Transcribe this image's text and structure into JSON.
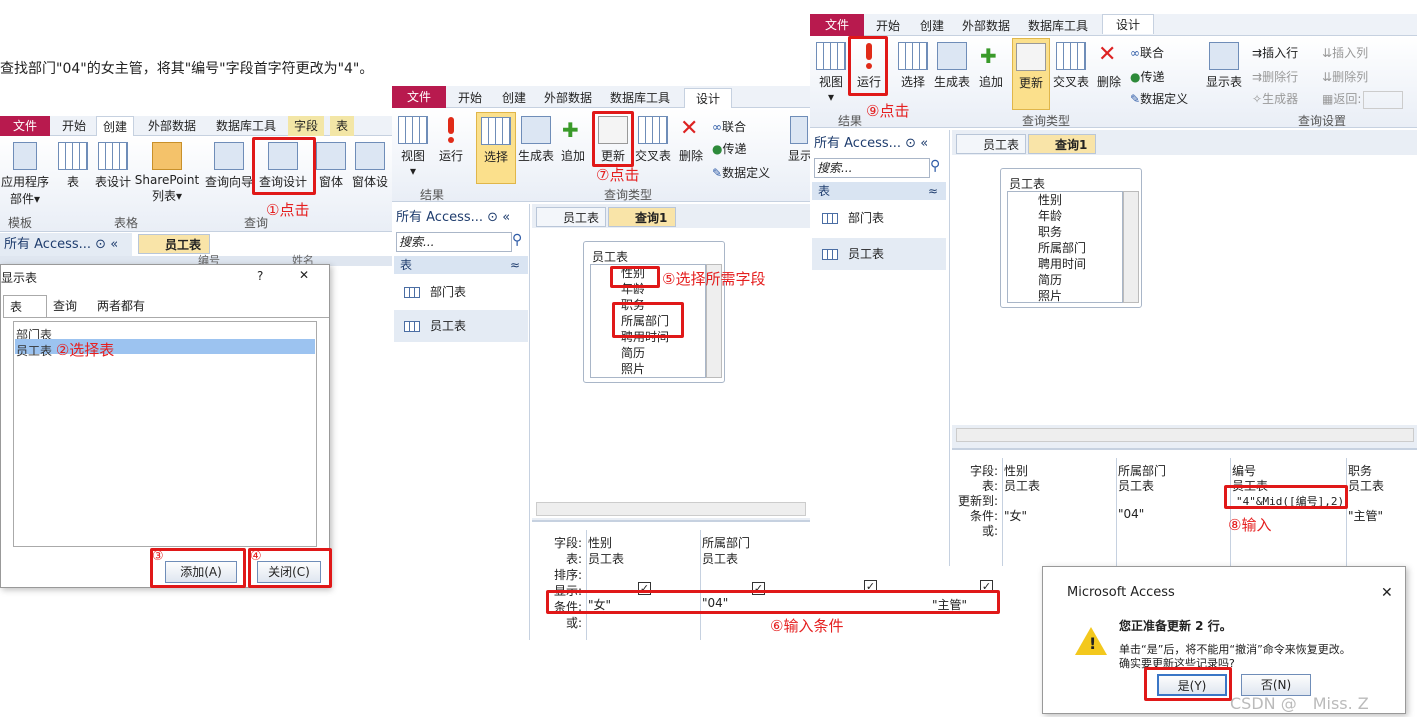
{
  "instruction": "查找部门\"04\"的女主管，将其\"编号\"字段首字符更改为\"4\"。",
  "win1": {
    "tabs": [
      "文件",
      "开始",
      "创建",
      "外部数据",
      "数据库工具",
      "字段",
      "表"
    ],
    "buttons": [
      "应用程序\n部件▾",
      "表",
      "表设计",
      "SharePoint\n列表▾",
      "查询向导",
      "查询设计",
      "窗体",
      "窗体设"
    ],
    "groups": [
      "模板",
      "表格",
      "查询"
    ],
    "nav_title": "所有 Access...",
    "search_placeholder": "搜索...",
    "doc_tab": "员工表",
    "col_headers": [
      "编号",
      "姓名"
    ]
  },
  "dialog_show_table": {
    "title": "显示表",
    "help": "?",
    "close": "✕",
    "tabs": [
      "表",
      "查询",
      "两者都有"
    ],
    "items": [
      "部门表",
      "员工表"
    ],
    "add_label": "添加(A)",
    "close_label": "关闭(C)"
  },
  "win2": {
    "tabs": [
      "文件",
      "开始",
      "创建",
      "外部数据",
      "数据库工具",
      "设计"
    ],
    "buttons": [
      "视图\n▾",
      "运行",
      "选择",
      "生成表",
      "追加",
      "更新",
      "交叉表",
      "删除",
      "显示"
    ],
    "small_buttons": [
      "联合",
      "传递",
      "数据定义"
    ],
    "groups": [
      "结果",
      "查询类型"
    ],
    "nav_title": "所有 Access...",
    "search_placeholder": "搜索...",
    "section": "表",
    "nav_items": [
      "部门表",
      "员工表"
    ],
    "doc_tabs": [
      "员工表",
      "查询1"
    ],
    "fieldlist_title": "员工表",
    "fields": [
      "性别",
      "年龄",
      "职务",
      "所属部门",
      "聘用时间",
      "简历",
      "照片"
    ],
    "grid_labels": [
      "字段:",
      "表:",
      "排序:",
      "显示:",
      "条件:",
      "或:"
    ],
    "grid_cols": [
      {
        "field": "性别",
        "table": "员工表",
        "criteria": "\"女\""
      },
      {
        "field": "所属部门",
        "table": "员工表",
        "criteria": "\"04\""
      },
      {
        "field": "",
        "table": "",
        "criteria": ""
      },
      {
        "field": "",
        "table": "",
        "criteria": "\"主管\""
      }
    ]
  },
  "win3": {
    "tabs": [
      "文件",
      "开始",
      "创建",
      "外部数据",
      "数据库工具",
      "设计"
    ],
    "buttons": [
      "视图\n▾",
      "运行",
      "选择",
      "生成表",
      "追加",
      "更新",
      "交叉表",
      "删除",
      "显示表"
    ],
    "small_buttons": [
      "联合",
      "传递",
      "数据定义"
    ],
    "small_buttons_right": [
      "插入行",
      "删除行",
      "生成器",
      "插入列",
      "删除列",
      "返回:"
    ],
    "groups": [
      "结果",
      "查询类型",
      "查询设置"
    ],
    "nav_title": "所有 Access...",
    "search_placeholder": "搜索...",
    "section": "表",
    "nav_items": [
      "部门表",
      "员工表"
    ],
    "doc_tabs": [
      "员工表",
      "查询1"
    ],
    "fieldlist_title": "员工表",
    "fields": [
      "性别",
      "年龄",
      "职务",
      "所属部门",
      "聘用时间",
      "简历",
      "照片"
    ],
    "grid_labels": [
      "字段:",
      "表:",
      "更新到:",
      "条件:",
      "或:"
    ],
    "grid_cols": [
      {
        "field": "性别",
        "table": "员工表",
        "update": "",
        "criteria": "\"女\""
      },
      {
        "field": "所属部门",
        "table": "员工表",
        "update": "",
        "criteria": "\"04\""
      },
      {
        "field": "编号",
        "table": "员工表",
        "update": "\"4\"&Mid([编号],2)",
        "criteria": ""
      },
      {
        "field": "职务",
        "table": "员工表",
        "update": "",
        "criteria": "\"主管\""
      }
    ]
  },
  "msgbox": {
    "title": "Microsoft Access",
    "close": "✕",
    "heading": "您正准备更新 2 行。",
    "body1": "单击“是”后，将不能用“撤消”命令来恢复更改。",
    "body2": "确实要更新这些记录吗?",
    "yes": "是(Y)",
    "no": "否(N)"
  },
  "annotations": {
    "a1": "①点击",
    "a2": "②选择表",
    "a3": "③",
    "a4": "④",
    "a5": "⑤选择所需字段",
    "a6": "⑥输入条件",
    "a7": "⑦点击",
    "a8": "⑧输入",
    "a9": "⑨点击"
  },
  "watermark": "CSDN @　Miss. Z",
  "colors": {
    "file_tab": "#b81a4e",
    "annotation": "#e52020",
    "highlight": "#f9d46a"
  }
}
